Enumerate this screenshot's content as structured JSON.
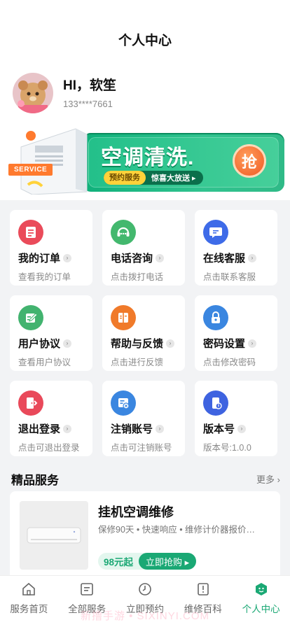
{
  "header": {
    "title": "个人中心"
  },
  "profile": {
    "name": "HI，软笙",
    "phone": "133****7661"
  },
  "banner": {
    "headline": "空调清洗.",
    "pill_left": "预约服务",
    "pill_right": "惊喜大放送 ▸",
    "grab": "抢",
    "service_tag": "SERVICE"
  },
  "menu": [
    {
      "label": "我的订单",
      "sub": "查看我的订单",
      "icon": "order-icon",
      "color": "#ea4b5a"
    },
    {
      "label": "电话咨询",
      "sub": "点击拨打电话",
      "icon": "phone-support-icon",
      "color": "#43b86e"
    },
    {
      "label": "在线客服",
      "sub": "点击联系客服",
      "icon": "chat-icon",
      "color": "#3e6be8"
    },
    {
      "label": "用户协议",
      "sub": "查看用户协议",
      "icon": "agreement-icon",
      "color": "#42b36f"
    },
    {
      "label": "帮助与反馈",
      "sub": "点击进行反馈",
      "icon": "help-book-icon",
      "color": "#f07a2a"
    },
    {
      "label": "密码设置",
      "sub": "点击修改密码",
      "icon": "lock-icon",
      "color": "#3a86e0"
    },
    {
      "label": "退出登录",
      "sub": "点击可退出登录",
      "icon": "logout-door-icon",
      "color": "#e9495a"
    },
    {
      "label": "注销账号",
      "sub": "点击可注销账号",
      "icon": "cancel-account-icon",
      "color": "#3a86e0"
    },
    {
      "label": "版本号",
      "sub": "版本号:1.0.0",
      "icon": "phone-info-icon",
      "color": "#3e63e0"
    }
  ],
  "section": {
    "title": "精品服务",
    "more": "更多"
  },
  "product": {
    "name": "挂机空调维修",
    "desc": "保修90天 • 快速响应 • 维修计价器报价…",
    "price": "98元起",
    "buy": "立即抢购 ▸"
  },
  "tabs": [
    {
      "label": "服务首页",
      "icon": "home-icon"
    },
    {
      "label": "全部服务",
      "icon": "list-icon"
    },
    {
      "label": "立即预约",
      "icon": "clock-icon"
    },
    {
      "label": "维修百科",
      "icon": "book-icon"
    },
    {
      "label": "个人中心",
      "icon": "profile-icon",
      "active": true
    }
  ],
  "watermark": "新撸手游 • SIXINYI.COM",
  "colors": {
    "accent": "#1aa874",
    "bg": "#f2f3f5"
  }
}
